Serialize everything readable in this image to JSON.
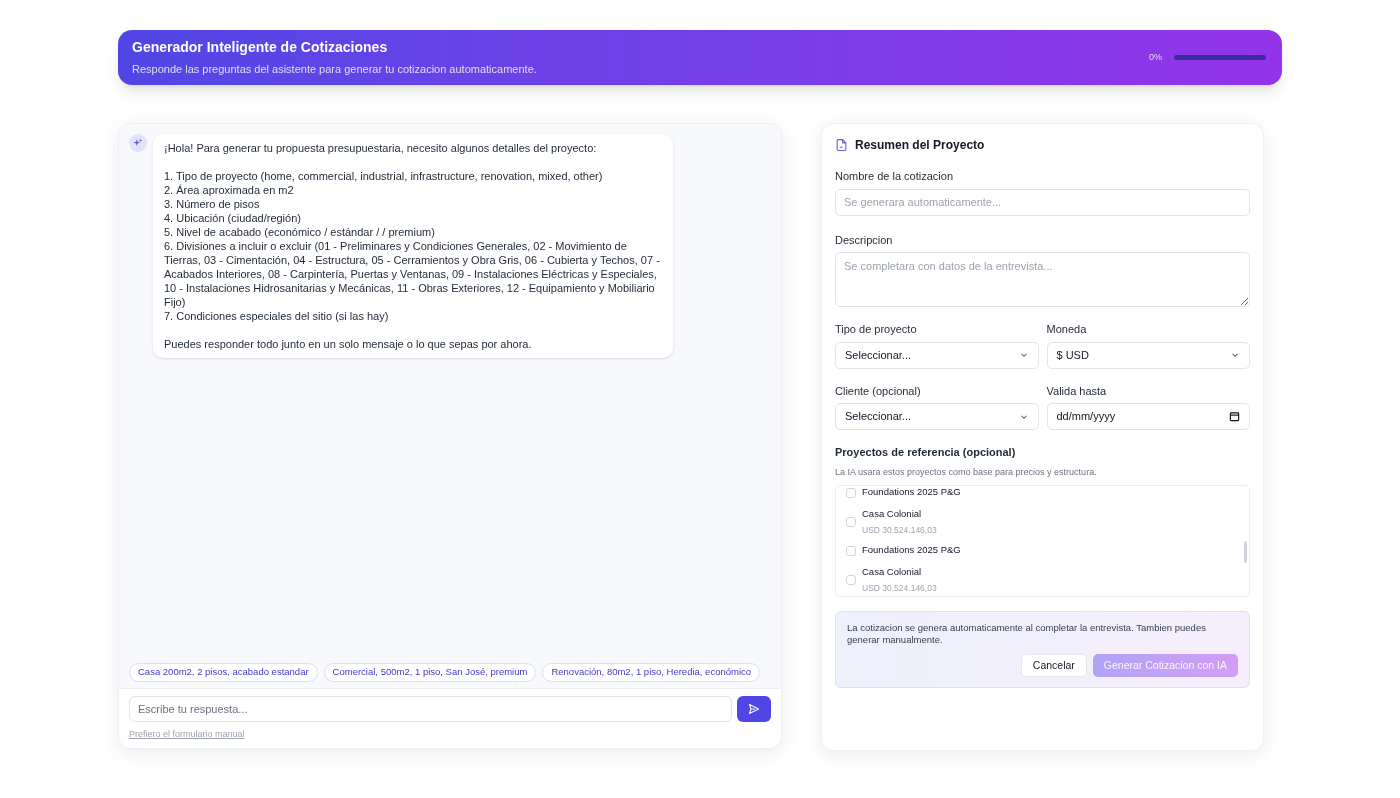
{
  "header": {
    "title": "Generador Inteligente de Cotizaciones",
    "subtitle": "Responde las preguntas del asistente para generar tu cotizacion automaticamente.",
    "progress": {
      "reading": "0%",
      "level": 0
    }
  },
  "chat": {
    "messages": [
      {
        "text": "¡Hola! Para generar tu propuesta presupuestaria, necesito algunos detalles del proyecto:\n\n1. Tipo de proyecto (home, commercial, industrial, infrastructure, renovation, mixed, other)\n2. Área aproximada en m2\n3. Número de pisos\n4. Ubicación (ciudad/región)\n5. Nivel de acabado (económico / estándar / / premium)\n6. Divisiones a incluir o excluir (01 - Preliminares y Condiciones Generales, 02 - Movimiento de Tierras, 03 - Cimentación, 04 - Estructura, 05 - Cerramientos y Obra Gris, 06 - Cubierta y Techos, 07 - Acabados Interiores, 08 - Carpintería, Puertas y Ventanas, 09 - Instalaciones Eléctricas y Especiales, 10 - Instalaciones Hidrosanitarias y Mecánicas, 11 - Obras Exteriores, 12 - Equipamiento y Mobiliario Fijo)\n7. Condiciones especiales del sitio (si las hay)\n\nPuedes responder todo junto en un solo mensaje o lo que sepas por ahora."
      }
    ],
    "suggestions": [
      "Casa 200m2, 2 pisos, acabado estandar",
      "Comercial, 500m2, 1 piso, San José, premium",
      "Renovación, 80m2, 1 piso, Heredia, económico"
    ],
    "input": {
      "placeholder": "Escribe tu respuesta..."
    },
    "manual_link": "Prefiero el formulario manual"
  },
  "summary": {
    "title": "Resumen del Proyecto",
    "name_field": {
      "label": "Nombre de la cotizacion",
      "placeholder": "Se generara automaticamente..."
    },
    "description_field": {
      "label": "Descripcion",
      "placeholder": "Se completara con datos de la entrevista..."
    },
    "selects": [
      {
        "label": "Tipo de proyecto",
        "value": "Seleccionar...",
        "kind": "select"
      },
      {
        "label": "Moneda",
        "value": "$ USD",
        "kind": "select"
      },
      {
        "label": "Cliente (opcional)",
        "value": "Seleccionar...",
        "kind": "select"
      },
      {
        "label": "Valida hasta",
        "value": "dd/mm/yyyy",
        "kind": "date"
      }
    ],
    "references": {
      "title": "Proyectos de referencia (opcional)",
      "hint": "La IA usara estos proyectos como base para precios y estructura.",
      "items": [
        {
          "name": "Foundations 2025 P&G",
          "checked": false
        },
        {
          "name": "Casa Colonial",
          "amount": "USD 30.524.146,03",
          "checked": false
        },
        {
          "name": "Foundations 2025 P&G",
          "checked": false
        },
        {
          "name": "Casa Colonial",
          "amount": "USD 30.524.146,03",
          "checked": false
        }
      ]
    },
    "notice": "La cotizacion se genera automaticamente al completar la entrevista. Tambien puedes generar manualmente.",
    "buttons": [
      {
        "label": "Cancelar",
        "kind": "secondary",
        "disabled": false
      },
      {
        "label": "Generar Cotizacion con IA",
        "kind": "primary",
        "disabled": true
      }
    ]
  }
}
